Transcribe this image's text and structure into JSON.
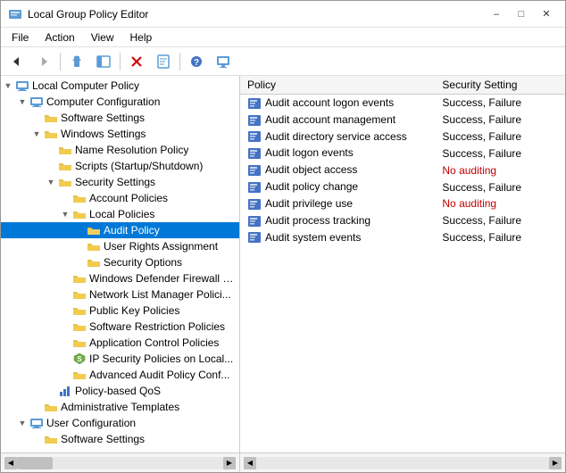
{
  "window": {
    "title": "Local Group Policy Editor",
    "min_label": "–",
    "max_label": "□",
    "close_label": "✕"
  },
  "menu": {
    "items": [
      "File",
      "Action",
      "View",
      "Help"
    ]
  },
  "toolbar": {
    "buttons": [
      "◀",
      "▶",
      "⬆",
      "📋",
      "✕",
      "✂",
      "📄",
      "❓",
      "🖥"
    ]
  },
  "left_pane": {
    "header": "Local Computer Policy",
    "tree": [
      {
        "id": "lcp",
        "label": "Local Computer Policy",
        "level": 0,
        "expanded": true,
        "icon": "computer"
      },
      {
        "id": "cc",
        "label": "Computer Configuration",
        "level": 1,
        "expanded": true,
        "icon": "computer"
      },
      {
        "id": "ss_soft",
        "label": "Software Settings",
        "level": 2,
        "expanded": false,
        "icon": "folder"
      },
      {
        "id": "ws",
        "label": "Windows Settings",
        "level": 2,
        "expanded": true,
        "icon": "folder"
      },
      {
        "id": "nrp",
        "label": "Name Resolution Policy",
        "level": 3,
        "expanded": false,
        "icon": "folder"
      },
      {
        "id": "scripts",
        "label": "Scripts (Startup/Shutdown)",
        "level": 3,
        "expanded": false,
        "icon": "folder"
      },
      {
        "id": "secsett",
        "label": "Security Settings",
        "level": 3,
        "expanded": true,
        "icon": "folder"
      },
      {
        "id": "accpol",
        "label": "Account Policies",
        "level": 4,
        "expanded": false,
        "icon": "folder"
      },
      {
        "id": "locpol",
        "label": "Local Policies",
        "level": 4,
        "expanded": true,
        "icon": "folder"
      },
      {
        "id": "auditpol",
        "label": "Audit Policy",
        "level": 5,
        "expanded": false,
        "icon": "folder_open",
        "selected": true
      },
      {
        "id": "ura",
        "label": "User Rights Assignment",
        "level": 5,
        "expanded": false,
        "icon": "folder"
      },
      {
        "id": "secopt",
        "label": "Security Options",
        "level": 5,
        "expanded": false,
        "icon": "folder"
      },
      {
        "id": "wdf",
        "label": "Windows Defender Firewall w...",
        "level": 4,
        "expanded": false,
        "icon": "folder"
      },
      {
        "id": "nlm",
        "label": "Network List Manager Polici...",
        "level": 4,
        "expanded": false,
        "icon": "folder"
      },
      {
        "id": "pubkey",
        "label": "Public Key Policies",
        "level": 4,
        "expanded": false,
        "icon": "folder"
      },
      {
        "id": "srp",
        "label": "Software Restriction Policies",
        "level": 4,
        "expanded": false,
        "icon": "folder"
      },
      {
        "id": "acp",
        "label": "Application Control Policies",
        "level": 4,
        "expanded": false,
        "icon": "folder"
      },
      {
        "id": "ipsec",
        "label": "IP Security Policies on Local...",
        "level": 4,
        "expanded": false,
        "icon": "shield"
      },
      {
        "id": "aap",
        "label": "Advanced Audit Policy Conf...",
        "level": 4,
        "expanded": false,
        "icon": "folder"
      },
      {
        "id": "pbqos",
        "label": "Policy-based QoS",
        "level": 3,
        "expanded": false,
        "icon": "chart"
      },
      {
        "id": "admtpl",
        "label": "Administrative Templates",
        "level": 2,
        "expanded": false,
        "icon": "folder"
      },
      {
        "id": "uc",
        "label": "User Configuration",
        "level": 1,
        "expanded": true,
        "icon": "computer"
      },
      {
        "id": "uc_soft",
        "label": "Software Settings",
        "level": 2,
        "expanded": false,
        "icon": "folder"
      }
    ]
  },
  "right_pane": {
    "columns": [
      "Policy",
      "Security Setting"
    ],
    "rows": [
      {
        "policy": "Audit account logon events",
        "setting": "Success, Failure",
        "red": false
      },
      {
        "policy": "Audit account management",
        "setting": "Success, Failure",
        "red": false
      },
      {
        "policy": "Audit directory service access",
        "setting": "Success, Failure",
        "red": false
      },
      {
        "policy": "Audit logon events",
        "setting": "Success, Failure",
        "red": false
      },
      {
        "policy": "Audit object access",
        "setting": "No auditing",
        "red": true
      },
      {
        "policy": "Audit policy change",
        "setting": "Success, Failure",
        "red": false
      },
      {
        "policy": "Audit privilege use",
        "setting": "No auditing",
        "red": true
      },
      {
        "policy": "Audit process tracking",
        "setting": "Success, Failure",
        "red": false
      },
      {
        "policy": "Audit system events",
        "setting": "Success, Failure",
        "red": false
      }
    ]
  }
}
